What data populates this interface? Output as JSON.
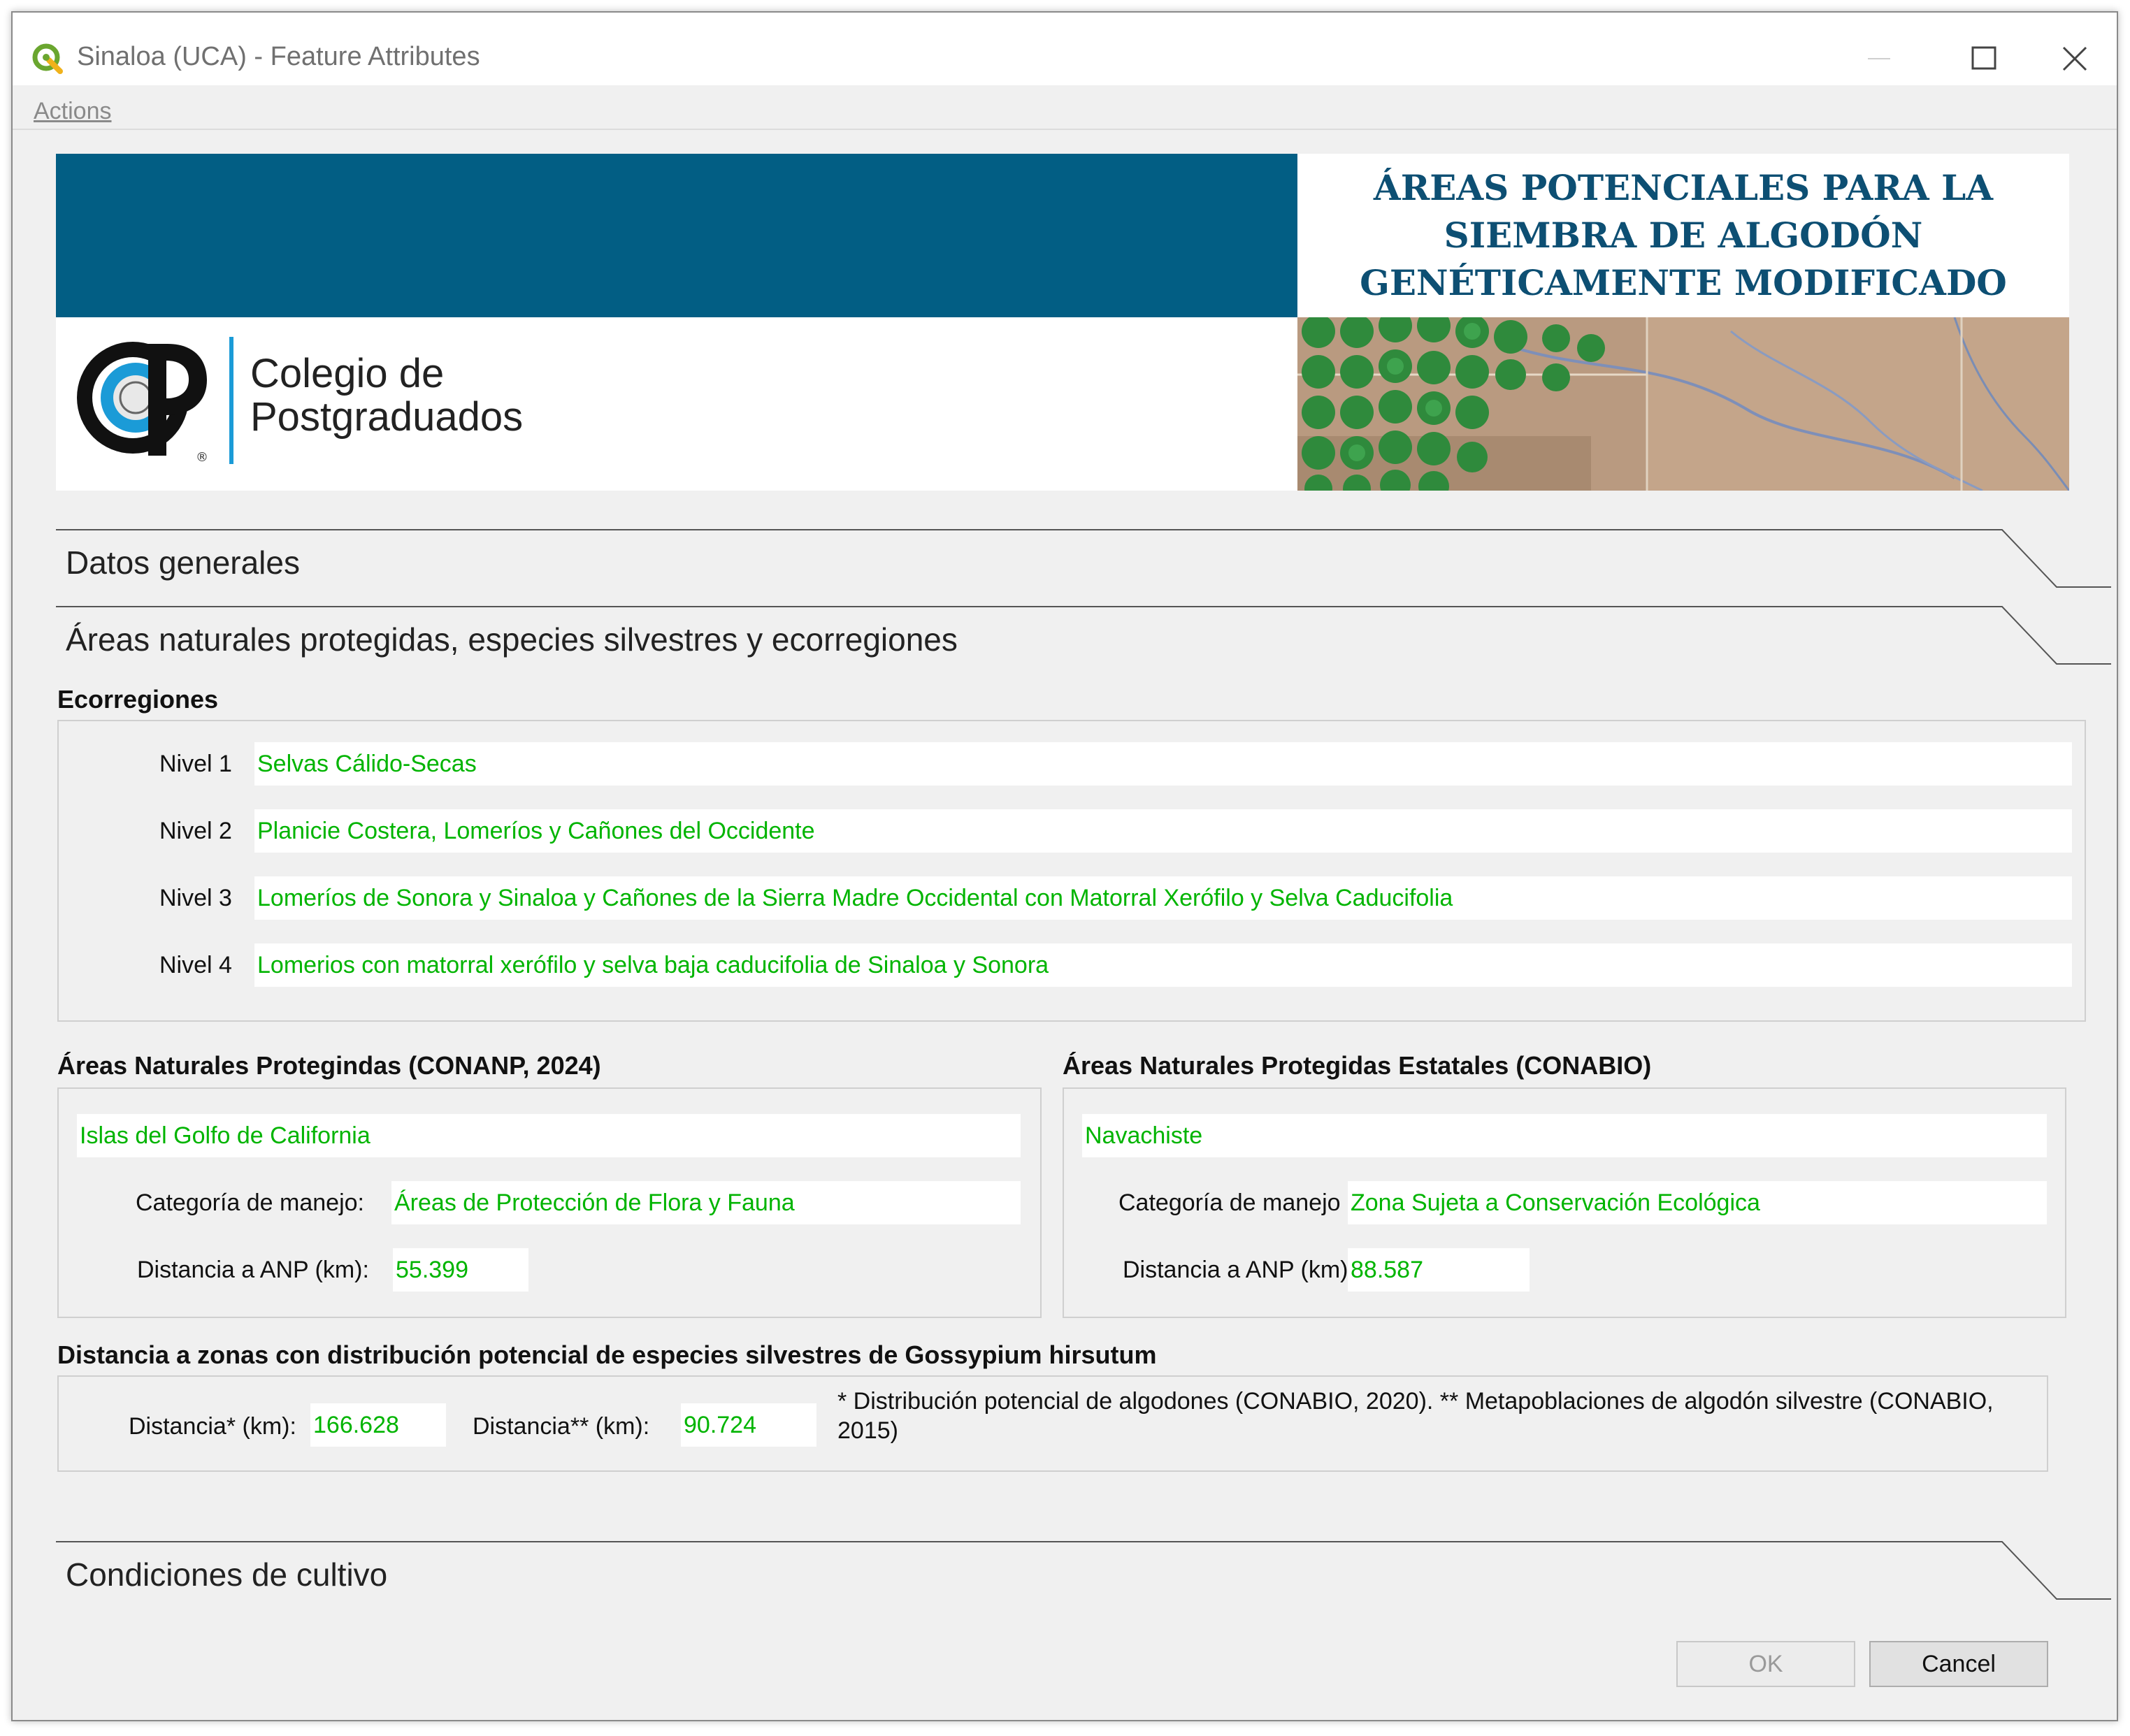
{
  "window": {
    "title": "Sinaloa (UCA) - Feature Attributes",
    "menu": [
      "Actions"
    ]
  },
  "banner": {
    "institution_line1": "Colegio de",
    "institution_line2": "Postgraduados",
    "title": "ÁREAS POTENCIALES PARA LA SIEMBRA DE ALGODÓN GENÉTICAMENTE MODIFICADO"
  },
  "sections": {
    "general": "Datos generales",
    "anp": "Áreas naturales protegidas, especies silvestres y ecorregiones",
    "cultivo": "Condiciones de cultivo"
  },
  "ecorregiones": {
    "label": "Ecorregiones",
    "rows": [
      {
        "label": "Nivel 1",
        "value": "Selvas Cálido-Secas"
      },
      {
        "label": "Nivel 2",
        "value": "Planicie Costera, Lomeríos y Cañones del Occidente"
      },
      {
        "label": "Nivel 3",
        "value": "Lomeríos de Sonora y Sinaloa y Cañones de la Sierra Madre Occidental con Matorral Xerófilo y Selva Caducifolia"
      },
      {
        "label": "Nivel 4",
        "value": "Lomerios con matorral xerófilo y selva baja caducifolia de Sinaloa y Sonora"
      }
    ]
  },
  "anp_federal": {
    "label": "Áreas Naturales Protegindas (CONANP, 2024)",
    "name": "Islas del Golfo de California",
    "categoria_label": "Categoría de manejo:",
    "categoria_value": "Áreas de Protección de Flora y Fauna",
    "distancia_label": "Distancia a ANP (km):",
    "distancia_value": "55.399"
  },
  "anp_estatal": {
    "label": "Áreas Naturales Protegidas Estatales (CONABIO)",
    "name": "Navachiste",
    "categoria_label": "Categoría de manejo",
    "categoria_value": "Zona Sujeta a Conservación Ecológica",
    "distancia_label": "Distancia a ANP (km)",
    "distancia_value": "88.587"
  },
  "gossypium": {
    "label": "Distancia a zonas con distribución potencial de especies silvestres de Gossypium hirsutum",
    "dist1_label": "Distancia* (km):",
    "dist1_value": "166.628",
    "dist2_label": "Distancia** (km):",
    "dist2_value": "90.724",
    "note": "* Distribución potencial de algodones (CONABIO, 2020). ** Metapoblaciones de algodón silvestre (CONABIO, 2015)"
  },
  "buttons": {
    "ok": "OK",
    "cancel": "Cancel"
  },
  "colors": {
    "banner_blue": "#025e84",
    "value_green": "#00b400",
    "title_navy": "#0d4f73"
  }
}
